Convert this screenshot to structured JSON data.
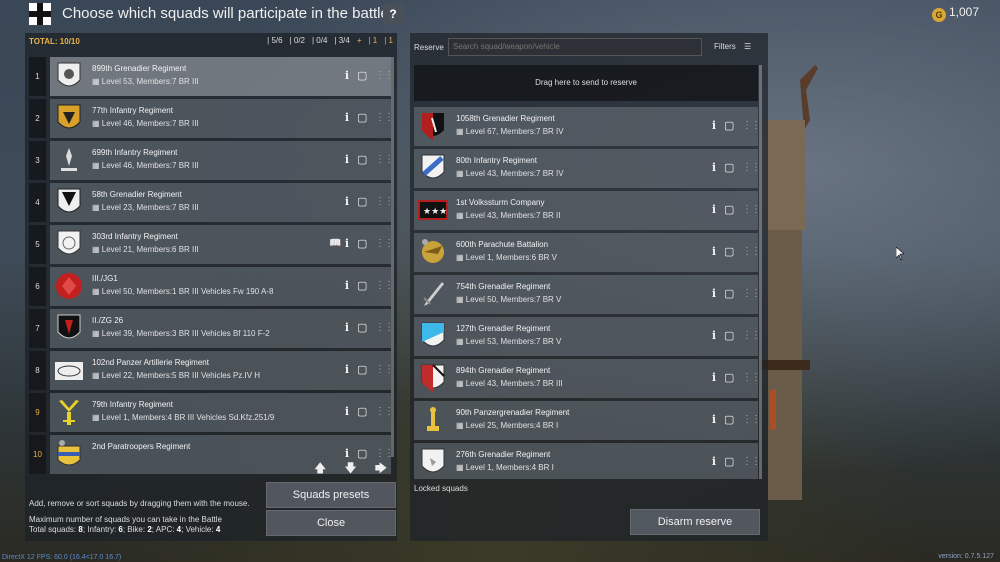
{
  "header": {
    "title": "Choose which squads will participate in the battle",
    "help_label": "?",
    "currency_value": "1,007"
  },
  "left_panel": {
    "total_label": "TOTAL: 10/10",
    "limits": [
      {
        "icon": "infantry-icon",
        "value": "5/6"
      },
      {
        "icon": "parachute-icon",
        "value": "0/2"
      },
      {
        "icon": "bike-icon",
        "value": "0/4"
      },
      {
        "icon": "tank-icon",
        "value": "3/4"
      },
      {
        "icon": "plus-icon",
        "value": "+"
      },
      {
        "icon": "vehicle-icon",
        "value": "1"
      },
      {
        "icon": "bar-icon",
        "value": "1"
      }
    ],
    "squads": [
      {
        "num": "1",
        "name": "899th Grenadier Regiment",
        "info": "Level 53, Members:7  BR III",
        "emblem": "shield-eagle"
      },
      {
        "num": "2",
        "name": "77th Infantry Regiment",
        "info": "Level 46, Members:7  BR III",
        "emblem": "shield-gold"
      },
      {
        "num": "3",
        "name": "699th Infantry Regiment",
        "info": "Level 46, Members:7  BR III",
        "emblem": "lily"
      },
      {
        "num": "4",
        "name": "58th Grenadier Regiment",
        "info": "Level 23, Members:7  BR III",
        "emblem": "shield-dark"
      },
      {
        "num": "5",
        "name": "303rd Infantry Regiment",
        "info": "Level 21, Members:6  BR III",
        "emblem": "shield-white"
      },
      {
        "num": "6",
        "name": "III./JG1",
        "info": "Level 50, Members:1  BR III  Vehicles Fw 190 A-8",
        "emblem": "red-circle"
      },
      {
        "num": "7",
        "name": "II./ZG 26",
        "info": "Level 39, Members:3  BR III  Vehicles Bf 110 F-2",
        "emblem": "shield-black-red"
      },
      {
        "num": "8",
        "name": "102nd Panzer Artillerie Regiment",
        "info": "Level 22, Members:5  BR III  Vehicles Pz.IV H",
        "emblem": "oval"
      },
      {
        "num": "9",
        "name": "79th Infantry Regiment",
        "info": "Level 1, Members:4  BR III  Vehicles Sd.Kfz.251/9",
        "emblem": "yellow-y"
      },
      {
        "num": "10",
        "name": "2nd Paratroopers Regiment",
        "info": "",
        "emblem": "shield-multi"
      }
    ],
    "hint": "Add, remove or sort squads by dragging them with the mouse.",
    "max_title": "Maximum number of squads you can take in the Battle",
    "max_label": "Total squads:",
    "max_parts": [
      {
        "label": "Infantry:",
        "value": "6"
      },
      {
        "label": "Bike:",
        "value": "2"
      },
      {
        "label": "APC:",
        "value": "4"
      },
      {
        "label": "Vehicle:",
        "value": "4"
      }
    ],
    "max_total": "8",
    "presets_label": "Squads presets",
    "close_label": "Close"
  },
  "right_panel": {
    "reserve_label": "Reserve",
    "search_placeholder": "Search squad/weapon/vehicle",
    "filters_label": "Filters",
    "dropzone_label": "Drag here to send to reserve",
    "reserves": [
      {
        "name": "1058th Grenadier Regiment",
        "info": "Level 67, Members:7  BR IV",
        "emblem": "shield-red-black"
      },
      {
        "name": "80th Infantry Regiment",
        "info": "Level 43, Members:7  BR IV",
        "emblem": "shield-blue"
      },
      {
        "name": "1st Volkssturm Company",
        "info": "Level 43, Members:7  BR II",
        "emblem": "volkssturm"
      },
      {
        "name": "600th Parachute Battalion",
        "info": "Level 1, Members:6  BR V",
        "emblem": "eagle-gold"
      },
      {
        "name": "754th Grenadier Regiment",
        "info": "Level 50, Members:7  BR V",
        "emblem": "sword"
      },
      {
        "name": "127th Grenadier Regiment",
        "info": "Level 53, Members:7  BR V",
        "emblem": "shield-lightblue"
      },
      {
        "name": "894th Grenadier Regiment",
        "info": "Level 43, Members:7  BR III",
        "emblem": "shield-red-white"
      },
      {
        "name": "90th Panzergrenadier Regiment",
        "info": "Level 25, Members:4  BR I",
        "emblem": "key-gold"
      },
      {
        "name": "276th Grenadier Regiment",
        "info": "Level 1, Members:4  BR I",
        "emblem": "shield-plain"
      }
    ],
    "locked_label": "Locked squads",
    "disarm_label": "Disarm reserve"
  },
  "status": {
    "left": "DirectX 12 FPS: 60.0 (16.4<17.0 16.7)",
    "right": "version: 0.7.5.127"
  },
  "colors": {
    "accent": "#e7b34a",
    "panel": "#1e2228",
    "row": "#6e7680"
  }
}
